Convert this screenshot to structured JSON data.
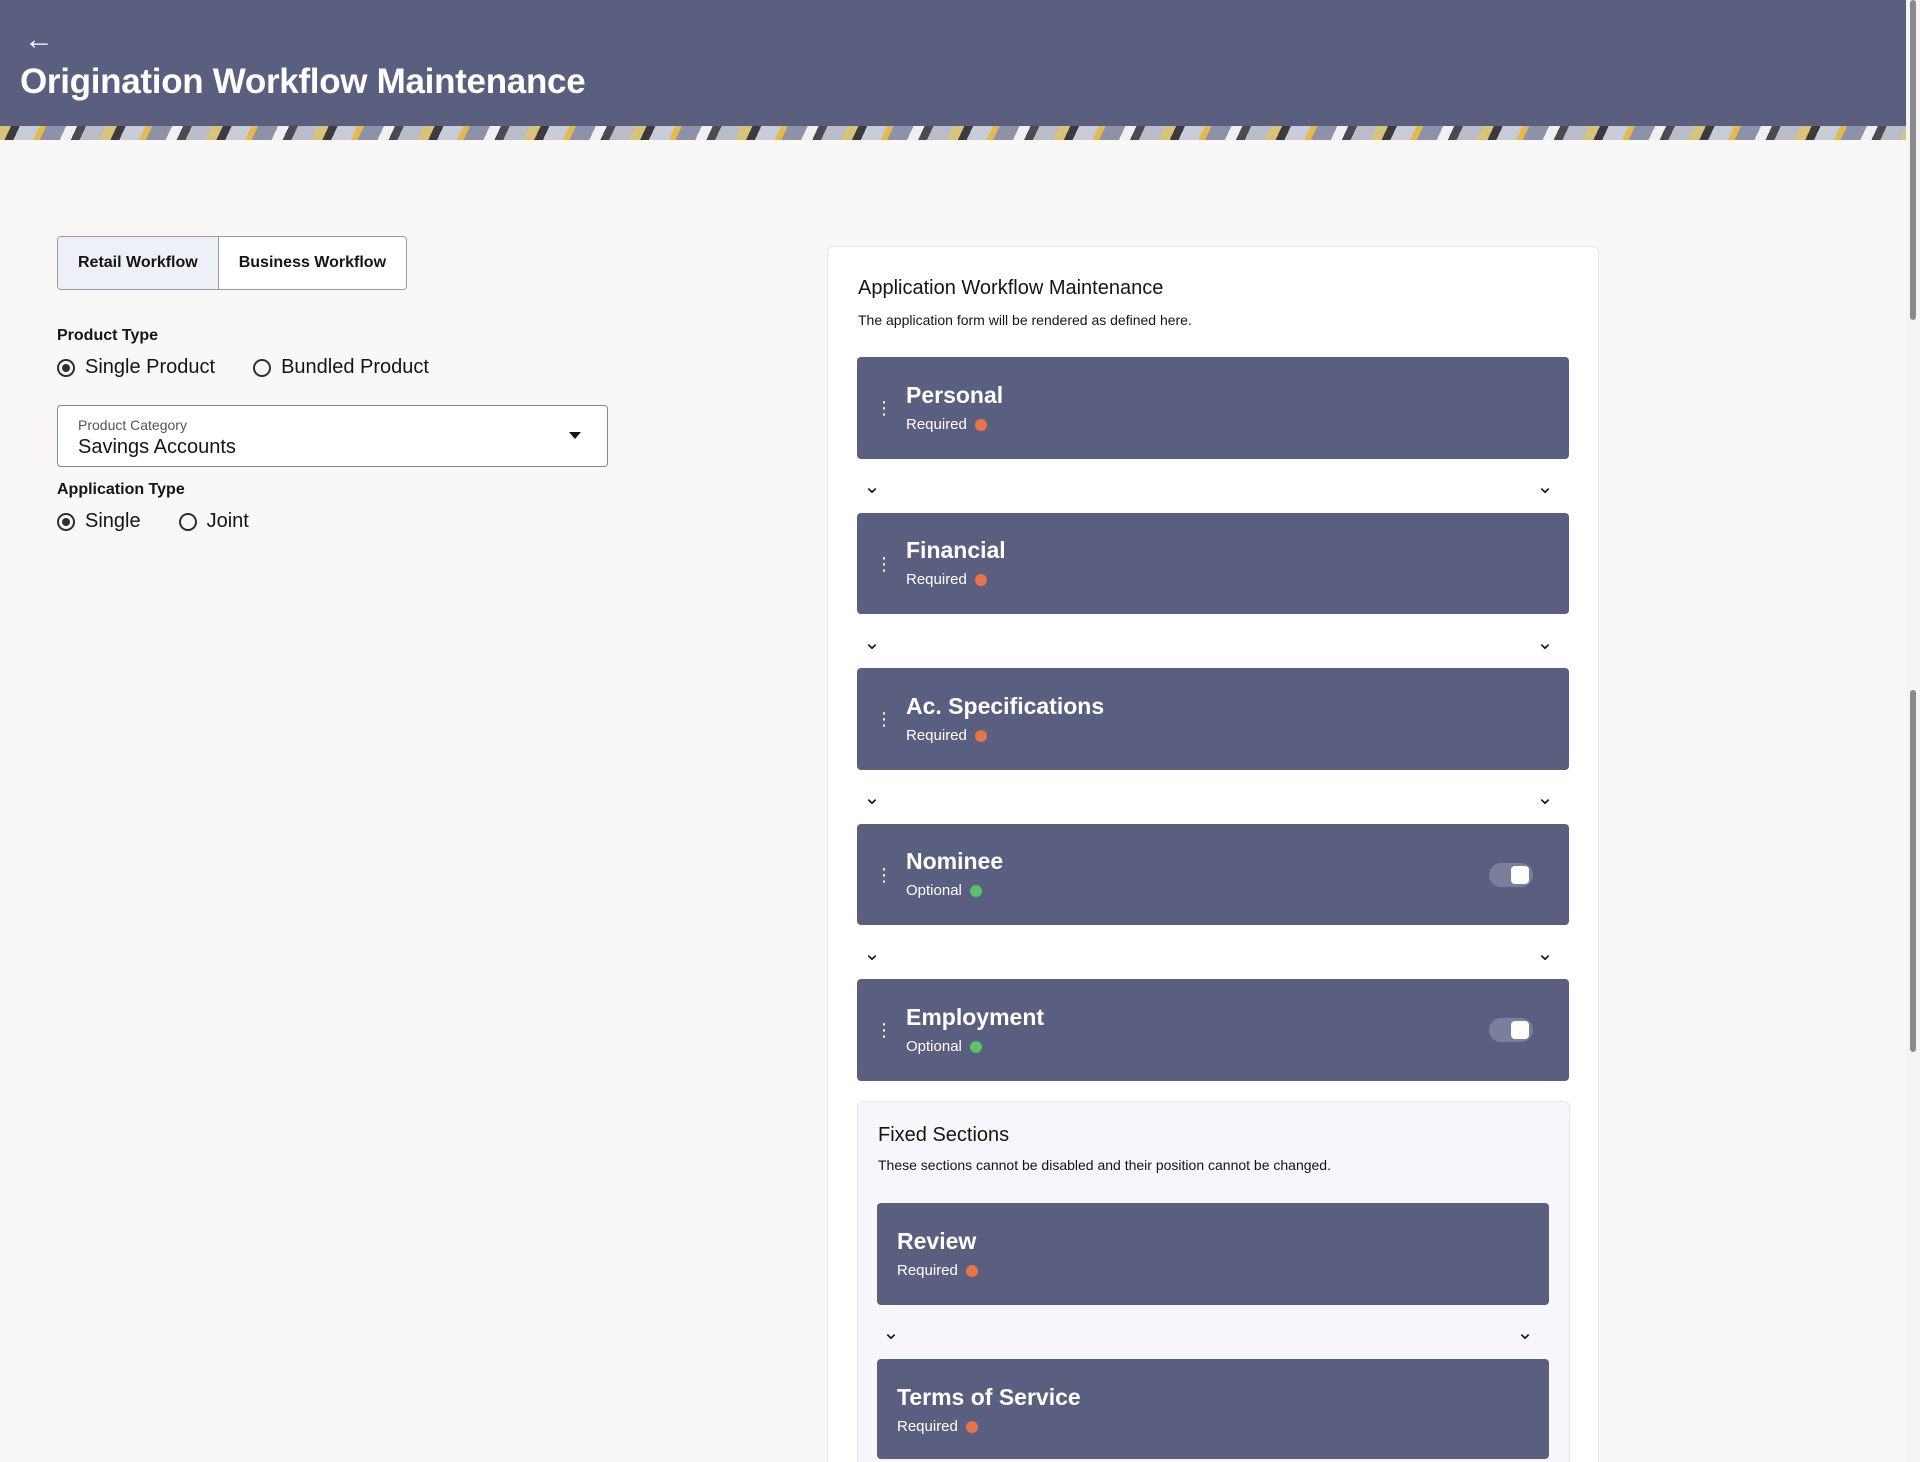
{
  "header": {
    "back_icon": "←",
    "title": "Origination Workflow Maintenance"
  },
  "tabs": [
    {
      "label": "Retail Workflow",
      "active": true
    },
    {
      "label": "Business Workflow",
      "active": false
    }
  ],
  "product_type": {
    "label": "Product Type",
    "options": [
      {
        "label": "Single Product",
        "selected": true
      },
      {
        "label": "Bundled Product",
        "selected": false
      }
    ]
  },
  "product_category": {
    "label": "Product Category",
    "value": "Savings Accounts"
  },
  "application_type": {
    "label": "Application Type",
    "options": [
      {
        "label": "Single",
        "selected": true
      },
      {
        "label": "Joint",
        "selected": false
      }
    ]
  },
  "panel": {
    "title": "Application Workflow Maintenance",
    "subtitle": "The application form will be rendered as defined here."
  },
  "sections": [
    {
      "title": "Personal",
      "status": "Required",
      "status_color": "#e8734a",
      "toggle": false
    },
    {
      "title": "Financial",
      "status": "Required",
      "status_color": "#e8734a",
      "toggle": false
    },
    {
      "title": "Ac. Specifications",
      "status": "Required",
      "status_color": "#e8734a",
      "toggle": false
    },
    {
      "title": "Nominee",
      "status": "Optional",
      "status_color": "#5bc06a",
      "toggle": true
    },
    {
      "title": "Employment",
      "status": "Optional",
      "status_color": "#5bc06a",
      "toggle": true
    }
  ],
  "fixed_sections": {
    "title": "Fixed Sections",
    "subtitle": "These sections cannot be disabled and their position cannot be changed.",
    "items": [
      {
        "title": "Review",
        "status": "Required",
        "status_color": "#e8734a"
      },
      {
        "title": "Terms of Service",
        "status": "Required",
        "status_color": "#e8734a"
      }
    ]
  },
  "icons": {
    "chevron": "chevron-double-down-icon",
    "drag": "drag-handle-icon"
  },
  "colors": {
    "header_bg": "#5a5f80",
    "card_bg": "#5a5f80",
    "required": "#e8734a",
    "optional": "#5bc06a"
  }
}
